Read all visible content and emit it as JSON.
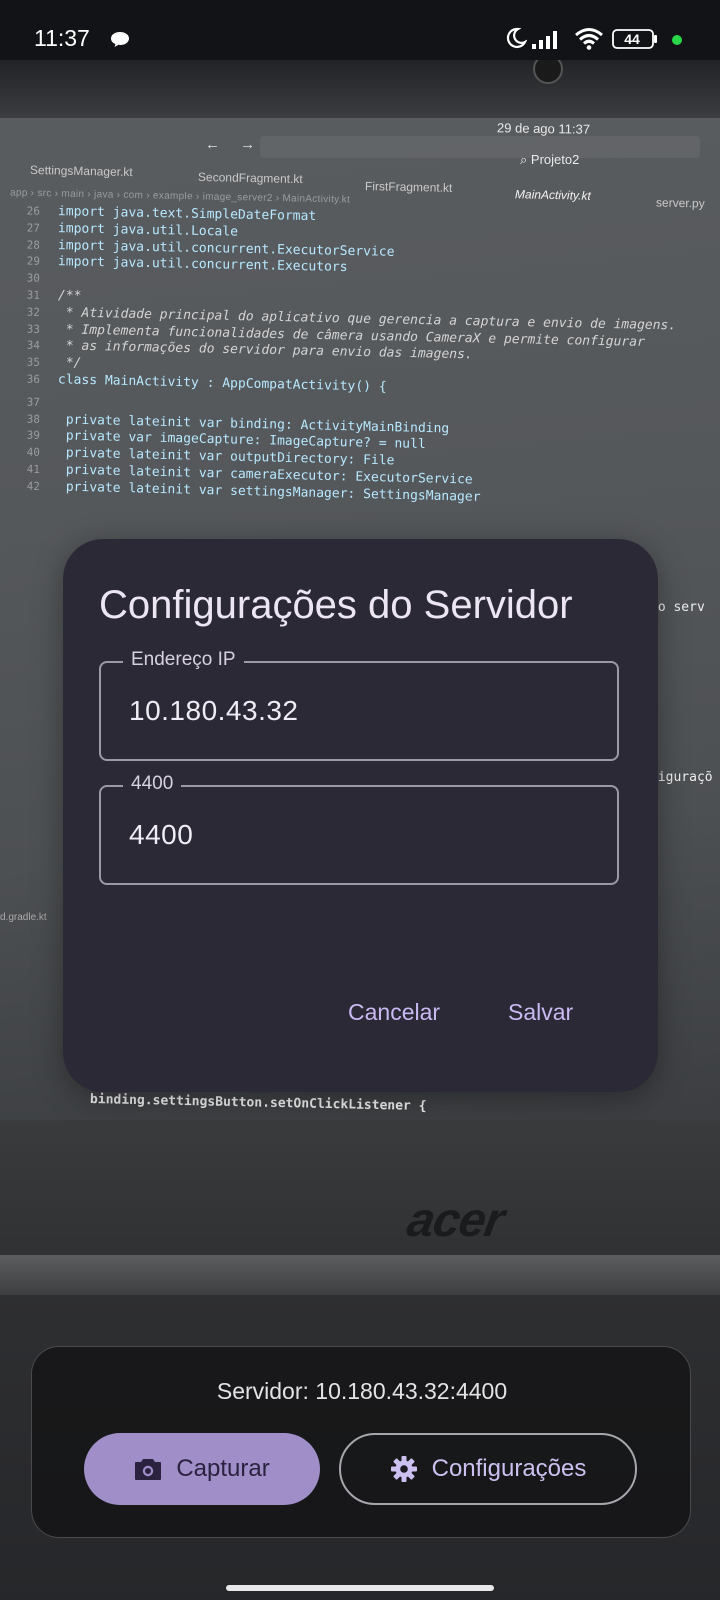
{
  "status_bar": {
    "time": "11:37",
    "battery": "44",
    "icons": [
      "chat-bubble-icon",
      "moon-icon",
      "signal-icon",
      "wifi-icon",
      "battery-icon",
      "camera-in-use-dot-icon"
    ]
  },
  "preview": {
    "ide_date": "29 de ago  11:37",
    "ide_project": "Projeto2",
    "ide_arrows": "← →",
    "tabs": [
      "SettingsManager.kt",
      "SecondFragment.kt",
      "FirstFragment.kt",
      "MainActivity.kt",
      "server.py"
    ],
    "breadcrumb": "app › src › main › java › com › example › image_server2 › MainActivity.kt",
    "code_lines": [
      {
        "n": "26",
        "t": "import java.text.SimpleDateFormat"
      },
      {
        "n": "27",
        "t": "import java.util.Locale"
      },
      {
        "n": "28",
        "t": "import java.util.concurrent.ExecutorService"
      },
      {
        "n": "29",
        "t": "import java.util.concurrent.Executors"
      },
      {
        "n": "30",
        "t": ""
      },
      {
        "n": "31",
        "t": "/**"
      },
      {
        "n": "32",
        "t": " * Atividade principal do aplicativo que gerencia a captura e envio de imagens."
      },
      {
        "n": "33",
        "t": " * Implementa funcionalidades de câmera usando CameraX e permite configurar"
      },
      {
        "n": "34",
        "t": " * as informações do servidor para envio das imagens."
      },
      {
        "n": "35",
        "t": " */"
      },
      {
        "n": "36",
        "t": "class MainActivity : AppCompatActivity() {"
      },
      {
        "n": "37",
        "t": ""
      },
      {
        "n": "38",
        "t": "    private lateinit var binding: ActivityMainBinding"
      },
      {
        "n": "39",
        "t": "    private var imageCapture: ImageCapture? = null"
      },
      {
        "n": "40",
        "t": "    private lateinit var outputDirectory: File"
      },
      {
        "n": "41",
        "t": "    private lateinit var cameraExecutor: ExecutorService"
      },
      {
        "n": "42",
        "t": "    private lateinit var settingsManager: SettingsManager"
      }
    ],
    "code_right_fragments": [
      "do serv",
      "figuraçõ"
    ],
    "code_bottom": "binding.settingsButton.setOnClickListener {",
    "side_file": "d.gradle.kt",
    "brand": "acer"
  },
  "dialog": {
    "title": "Configurações do Servidor",
    "ip_field": {
      "label": "Endereço IP",
      "value": "10.180.43.32"
    },
    "port_field": {
      "label": "4400",
      "value": "4400"
    },
    "cancel_label": "Cancelar",
    "save_label": "Salvar",
    "accent_color": "#c9b9f2"
  },
  "panel": {
    "server_text": "Servidor: 10.180.43.32:4400",
    "capture_label": "Capturar",
    "settings_label": "Configurações",
    "capture_color": "#9f8ec8"
  }
}
